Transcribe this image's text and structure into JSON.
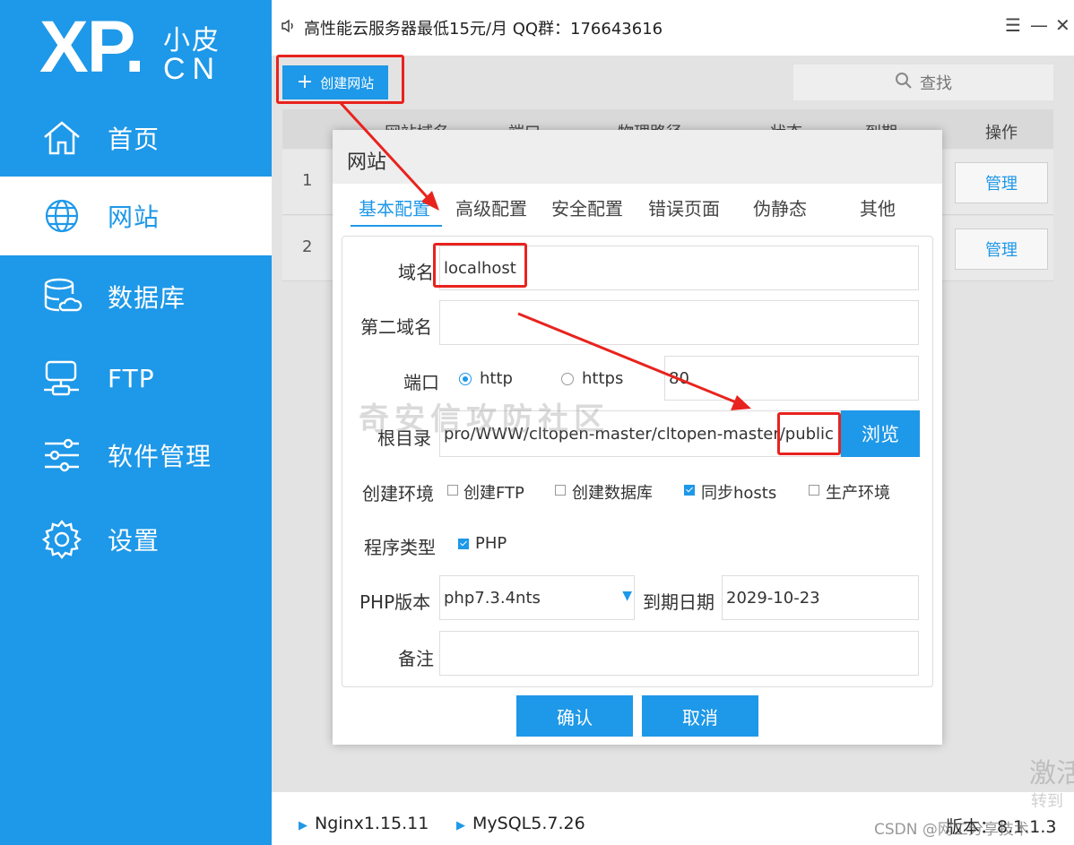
{
  "sidebar": {
    "logo": {
      "main": "XP.",
      "cn_top": "小皮",
      "cn_bottom": "CN"
    },
    "items": [
      {
        "label": "首页",
        "icon": "home-icon"
      },
      {
        "label": "网站",
        "icon": "globe-icon",
        "active": true
      },
      {
        "label": "数据库",
        "icon": "database-icon"
      },
      {
        "label": "FTP",
        "icon": "ftp-icon"
      },
      {
        "label": "软件管理",
        "icon": "sliders-icon"
      },
      {
        "label": "设置",
        "icon": "gear-icon"
      }
    ]
  },
  "titlebar": {
    "notice": "高性能云服务器最低15元/月  QQ群：176643616",
    "controls": [
      "☰",
      "—",
      "✕"
    ]
  },
  "toolbar": {
    "create_label": "创建网站",
    "search_label": "查找"
  },
  "table": {
    "headers": [
      "网站域名",
      "端口",
      "物理路径",
      "状态",
      "到期",
      "操作"
    ],
    "rows": [
      {
        "num": "1",
        "action": "管理"
      },
      {
        "num": "2",
        "action": "管理"
      }
    ]
  },
  "dialog": {
    "title": "网站",
    "tabs": [
      "基本配置",
      "高级配置",
      "安全配置",
      "错误页面",
      "伪静态",
      "其他"
    ],
    "form": {
      "domain_label": "域名",
      "domain_value": "localhost",
      "second_domain_label": "第二域名",
      "second_domain_value": "",
      "port_label": "端口",
      "http_label": "http",
      "https_label": "https",
      "port_value": "80",
      "root_label": "根目录",
      "root_value": "pro/WWW/cltopen-master/cltopen-master/public",
      "browse_label": "浏览",
      "env_label": "创建环境",
      "env_options": [
        {
          "label": "创建FTP",
          "checked": false
        },
        {
          "label": "创建数据库",
          "checked": false
        },
        {
          "label": "同步hosts",
          "checked": true
        },
        {
          "label": "生产环境",
          "checked": false
        }
      ],
      "program_label": "程序类型",
      "program_option": "PHP",
      "php_version_label": "PHP版本",
      "php_version_value": "php7.3.4nts",
      "expire_label": "到期日期",
      "expire_value": "2029-10-23",
      "note_label": "备注",
      "note_value": ""
    },
    "confirm_label": "确认",
    "cancel_label": "取消"
  },
  "statusbar": {
    "nginx": "Nginx1.15.11",
    "mysql": "MySQL5.7.26",
    "version": "版本：8.1.1.3"
  },
  "watermarks": {
    "center": "奇安信攻防社区",
    "right_top": "激活",
    "right_mid": "转到",
    "csdn": "CSDN @网工分享技术"
  },
  "colors": {
    "accent": "#1e98e8",
    "annotation": "#e8231e"
  }
}
